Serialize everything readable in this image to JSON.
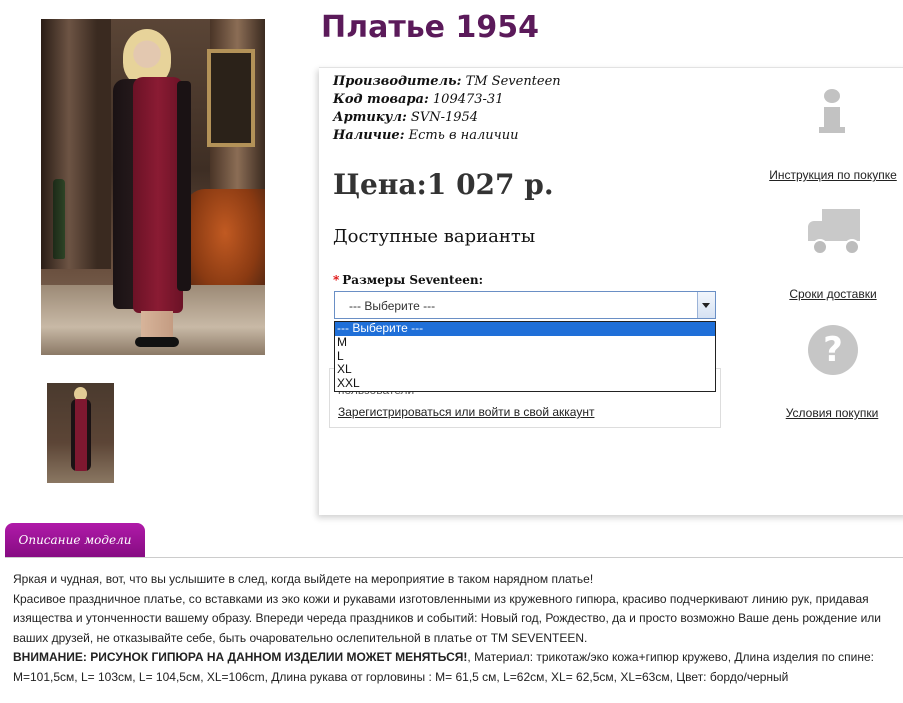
{
  "product": {
    "title": "Платье 1954",
    "manufacturer_label": "Производитель:",
    "manufacturer_value": "TM Seventeen",
    "code_label": "Код товара:",
    "code_value": "109473-31",
    "article_label": "Артикул:",
    "article_value": "SVN-1954",
    "availability_label": "Наличие:",
    "availability_value": "Есть в наличии",
    "price": "Цена:1 027 р."
  },
  "options": {
    "title": "Доступные варианты",
    "size_label": "Размеры Seventeen:",
    "required_mark": "*",
    "selected": "--- Выберите ---",
    "list": [
      "--- Выберите ---",
      "M",
      "L",
      "XL",
      "XXL"
    ]
  },
  "login": {
    "hint": "пользователи",
    "link": "Зарегистрироваться или войти в свой аккаунт"
  },
  "sidebar": {
    "instructions": "Инструкция по покупке",
    "delivery": "Сроки доставки",
    "terms": "Условия покупки"
  },
  "description": {
    "tab": "Описание модели",
    "line1": "Яркая и чудная, вот, что вы услышите в след, когда выйдете на мероприятие в таком нарядном платье!",
    "line2": "Красивое праздничное платье, со вставками из эко кожи и рукавами изготовленными из кружевного гипюра, красиво подчеркивают линию рук, придавая изящества и утонченности вашему образу. Впереди череда праздников и событий: Новый год, Рождество, да и просто возможно Ваше день рождение или ваших друзей, не отказывайте себе, быть очаровательно ослепительной в платье от TM SEVENTEEN.",
    "warning_bold": "ВНИМАНИЕ: РИСУНОК ГИПЮРА НА ДАННОМ ИЗДЕЛИИ МОЖЕТ МЕНЯТЬСЯ!",
    "material_label": "Материал:",
    "material_value": "трикотаж/эко кожа+гипюр кружево,",
    "length_label": "Длина изделия по спине:",
    "length_value": "M=101,5см, L= 103см, L= 104,5см, XL=106cm,",
    "sleeve_label": "Длина рукава от горловины :",
    "sleeve_value": "M= 61,5 см, L=62см, XL= 62,5см, XL=63см,",
    "color_label": "Цвет:",
    "color_value": "бордо/черный"
  },
  "colors": {
    "title": "#5b1a5a",
    "tab": "#9b1496",
    "select_highlight": "#1f6fd8"
  }
}
